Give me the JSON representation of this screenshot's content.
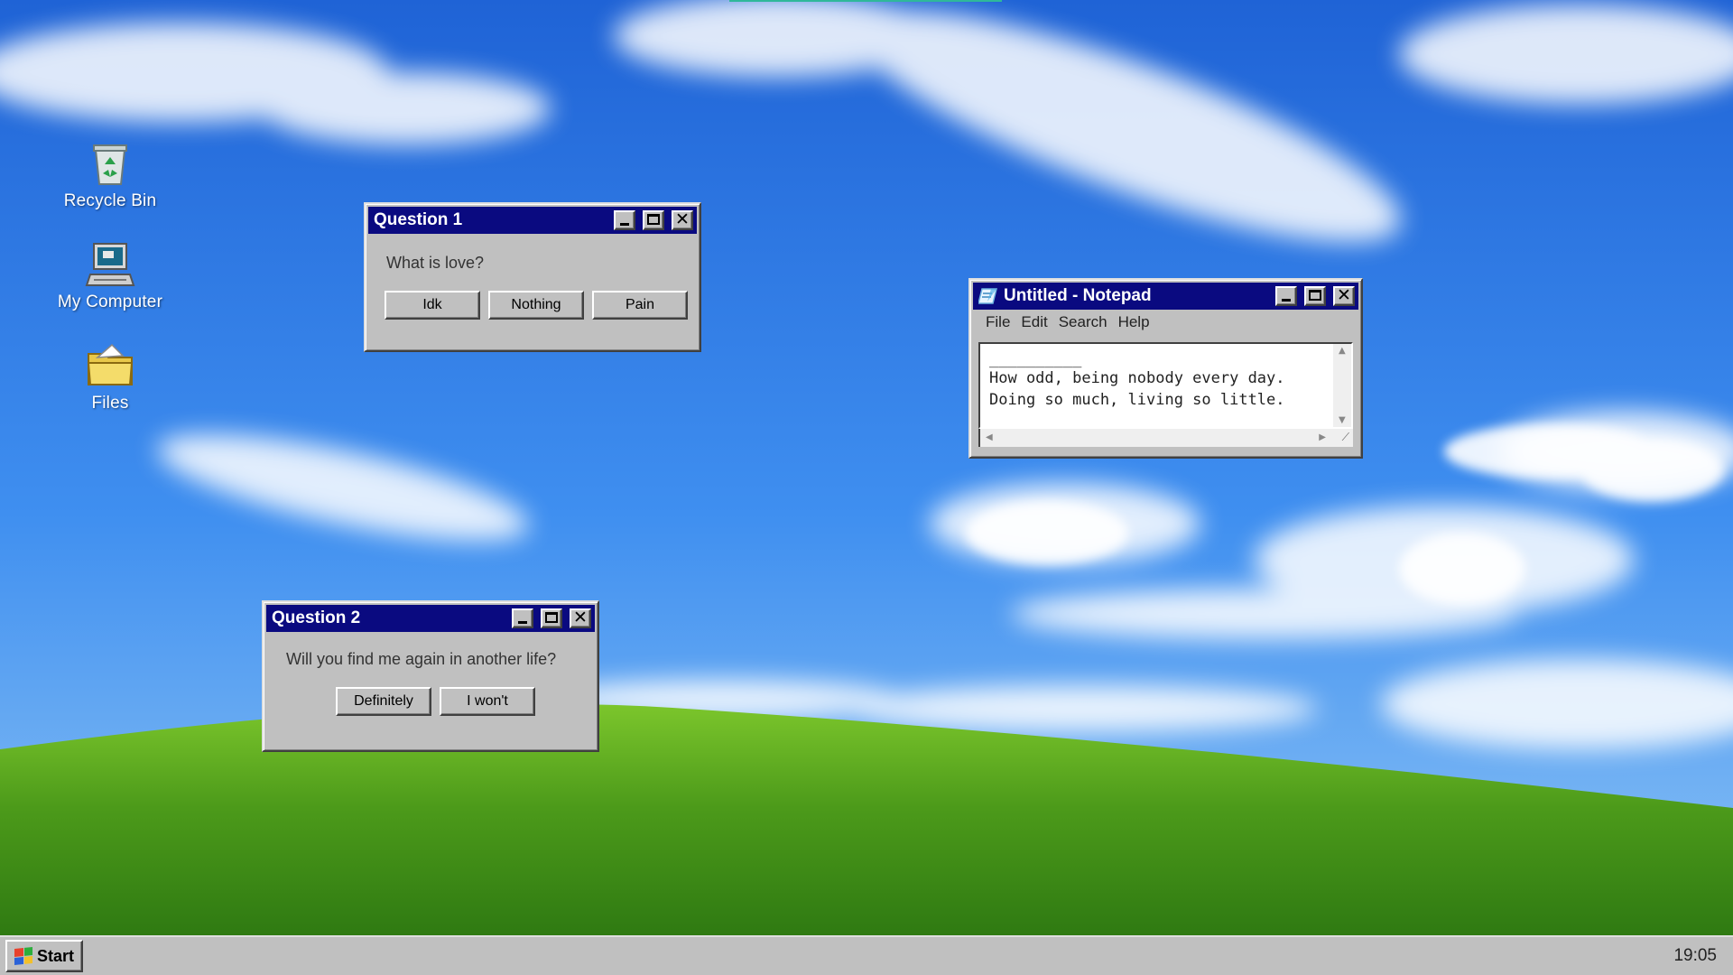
{
  "desktop": {
    "icons": [
      {
        "label": "Recycle Bin",
        "icon": "recycle-bin-icon"
      },
      {
        "label": "My Computer",
        "icon": "computer-icon"
      },
      {
        "label": "Files",
        "icon": "folder-icon"
      }
    ]
  },
  "question1": {
    "title": "Question 1",
    "message": "What is love?",
    "buttons": [
      "Idk",
      "Nothing",
      "Pain"
    ]
  },
  "question2": {
    "title": "Question 2",
    "message": "Will you find me again in another life?",
    "buttons": [
      "Definitely",
      "I won't"
    ]
  },
  "notepad": {
    "title": "Untitled - Notepad",
    "menu": [
      "File",
      "Edit",
      "Search",
      "Help"
    ],
    "lines": [
      "__________",
      "How odd, being nobody every day.",
      "Doing so much, living so little."
    ]
  },
  "taskbar": {
    "start_label": "Start",
    "clock": "19:05"
  },
  "colors": {
    "titlebar": "#0a0a80",
    "window_face": "#c0c0c0",
    "sky": "#3a7fe0",
    "grass": "#5fae1f"
  }
}
